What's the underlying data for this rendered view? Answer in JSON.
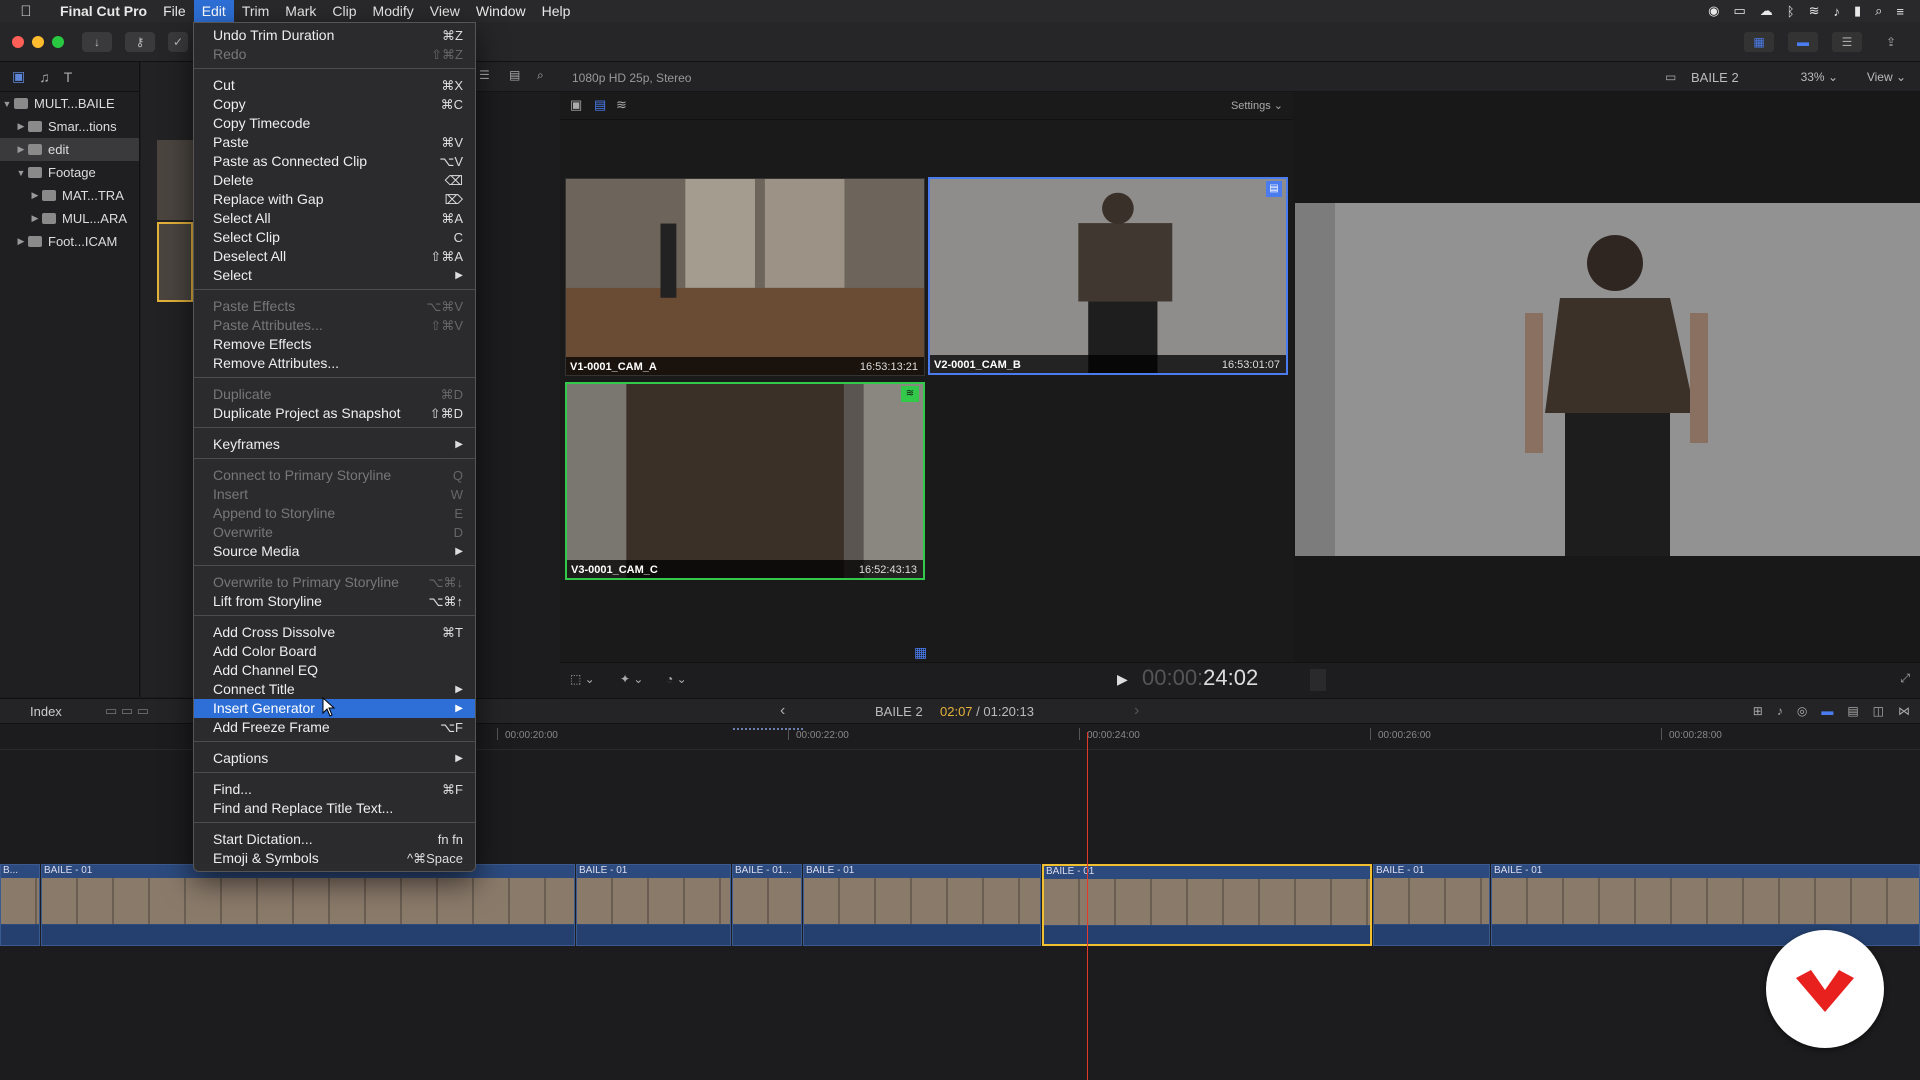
{
  "menubar": {
    "app": "Final Cut Pro",
    "items": [
      "File",
      "Edit",
      "Trim",
      "Mark",
      "Clip",
      "Modify",
      "View",
      "Window",
      "Help"
    ]
  },
  "sidebar": {
    "items": [
      {
        "label": "MULT...BAILE"
      },
      {
        "label": "Smar...tions"
      },
      {
        "label": "edit"
      },
      {
        "label": "Footage"
      },
      {
        "label": "MAT...TRA"
      },
      {
        "label": "MUL...ARA"
      },
      {
        "label": "Foot...ICAM"
      }
    ]
  },
  "viewer": {
    "format": "1080p HD 25p, Stereo",
    "project": "BAILE 2",
    "zoom": "33%",
    "view_label": "View",
    "settings_label": "Settings",
    "angles": [
      {
        "name": "V1-0001_CAM_A",
        "timecode": "16:53:13:21"
      },
      {
        "name": "V2-0001_CAM_B",
        "timecode": "16:53:01:07"
      },
      {
        "name": "V3-0001_CAM_C",
        "timecode": "16:52:43:13"
      }
    ],
    "timecode_dim": "00:00:",
    "timecode_main": "24:02"
  },
  "timeline": {
    "index_label": "Index",
    "title": "BAILE 2",
    "position": "02:07",
    "duration": " / 01:20:13",
    "ruler": [
      "00:00:20:00",
      "00:00:22:00",
      "00:00:24:00",
      "00:00:26:00",
      "00:00:28:00"
    ],
    "clips": [
      "B...",
      "BAILE - 01",
      "BAILE - 01",
      "BAILE - 01...",
      "BAILE - 01",
      "BAILE - 01",
      "BAILE - 01",
      "BAILE - 01"
    ]
  },
  "edit_menu": {
    "undo": {
      "label": "Undo Trim Duration",
      "shortcut": "⌘Z"
    },
    "redo": {
      "label": "Redo",
      "shortcut": "⇧⌘Z"
    },
    "cut": {
      "label": "Cut",
      "shortcut": "⌘X"
    },
    "copy": {
      "label": "Copy",
      "shortcut": "⌘C"
    },
    "copy_timecode": {
      "label": "Copy Timecode",
      "shortcut": ""
    },
    "paste": {
      "label": "Paste",
      "shortcut": "⌘V"
    },
    "paste_connected": {
      "label": "Paste as Connected Clip",
      "shortcut": "⌥V"
    },
    "delete": {
      "label": "Delete",
      "shortcut": "⌫"
    },
    "replace_gap": {
      "label": "Replace with Gap",
      "shortcut": "⌦"
    },
    "select_all": {
      "label": "Select All",
      "shortcut": "⌘A"
    },
    "select_clip": {
      "label": "Select Clip",
      "shortcut": "C"
    },
    "deselect_all": {
      "label": "Deselect All",
      "shortcut": "⇧⌘A"
    },
    "select": {
      "label": "Select"
    },
    "paste_effects": {
      "label": "Paste Effects",
      "shortcut": "⌥⌘V"
    },
    "paste_attributes": {
      "label": "Paste Attributes...",
      "shortcut": "⇧⌘V"
    },
    "remove_effects": {
      "label": "Remove Effects"
    },
    "remove_attributes": {
      "label": "Remove Attributes..."
    },
    "duplicate": {
      "label": "Duplicate",
      "shortcut": "⌘D"
    },
    "duplicate_snapshot": {
      "label": "Duplicate Project as Snapshot",
      "shortcut": "⇧⌘D"
    },
    "keyframes": {
      "label": "Keyframes"
    },
    "connect_primary": {
      "label": "Connect to Primary Storyline",
      "shortcut": "Q"
    },
    "insert": {
      "label": "Insert",
      "shortcut": "W"
    },
    "append": {
      "label": "Append to Storyline",
      "shortcut": "E"
    },
    "overwrite": {
      "label": "Overwrite",
      "shortcut": "D"
    },
    "source_media": {
      "label": "Source Media"
    },
    "overwrite_primary": {
      "label": "Overwrite to Primary Storyline",
      "shortcut": "⌥⌘↓"
    },
    "lift": {
      "label": "Lift from Storyline",
      "shortcut": "⌥⌘↑"
    },
    "cross_dissolve": {
      "label": "Add Cross Dissolve",
      "shortcut": "⌘T"
    },
    "color_board": {
      "label": "Add Color Board"
    },
    "channel_eq": {
      "label": "Add Channel EQ"
    },
    "connect_title": {
      "label": "Connect Title"
    },
    "insert_generator": {
      "label": "Insert Generator"
    },
    "freeze_frame": {
      "label": "Add Freeze Frame",
      "shortcut": "⌥F"
    },
    "captions": {
      "label": "Captions"
    },
    "find": {
      "label": "Find...",
      "shortcut": "⌘F"
    },
    "find_replace": {
      "label": "Find and Replace Title Text..."
    },
    "dictation": {
      "label": "Start Dictation...",
      "shortcut": "fn fn"
    },
    "emoji": {
      "label": "Emoji & Symbols",
      "shortcut": "^⌘Space"
    }
  }
}
